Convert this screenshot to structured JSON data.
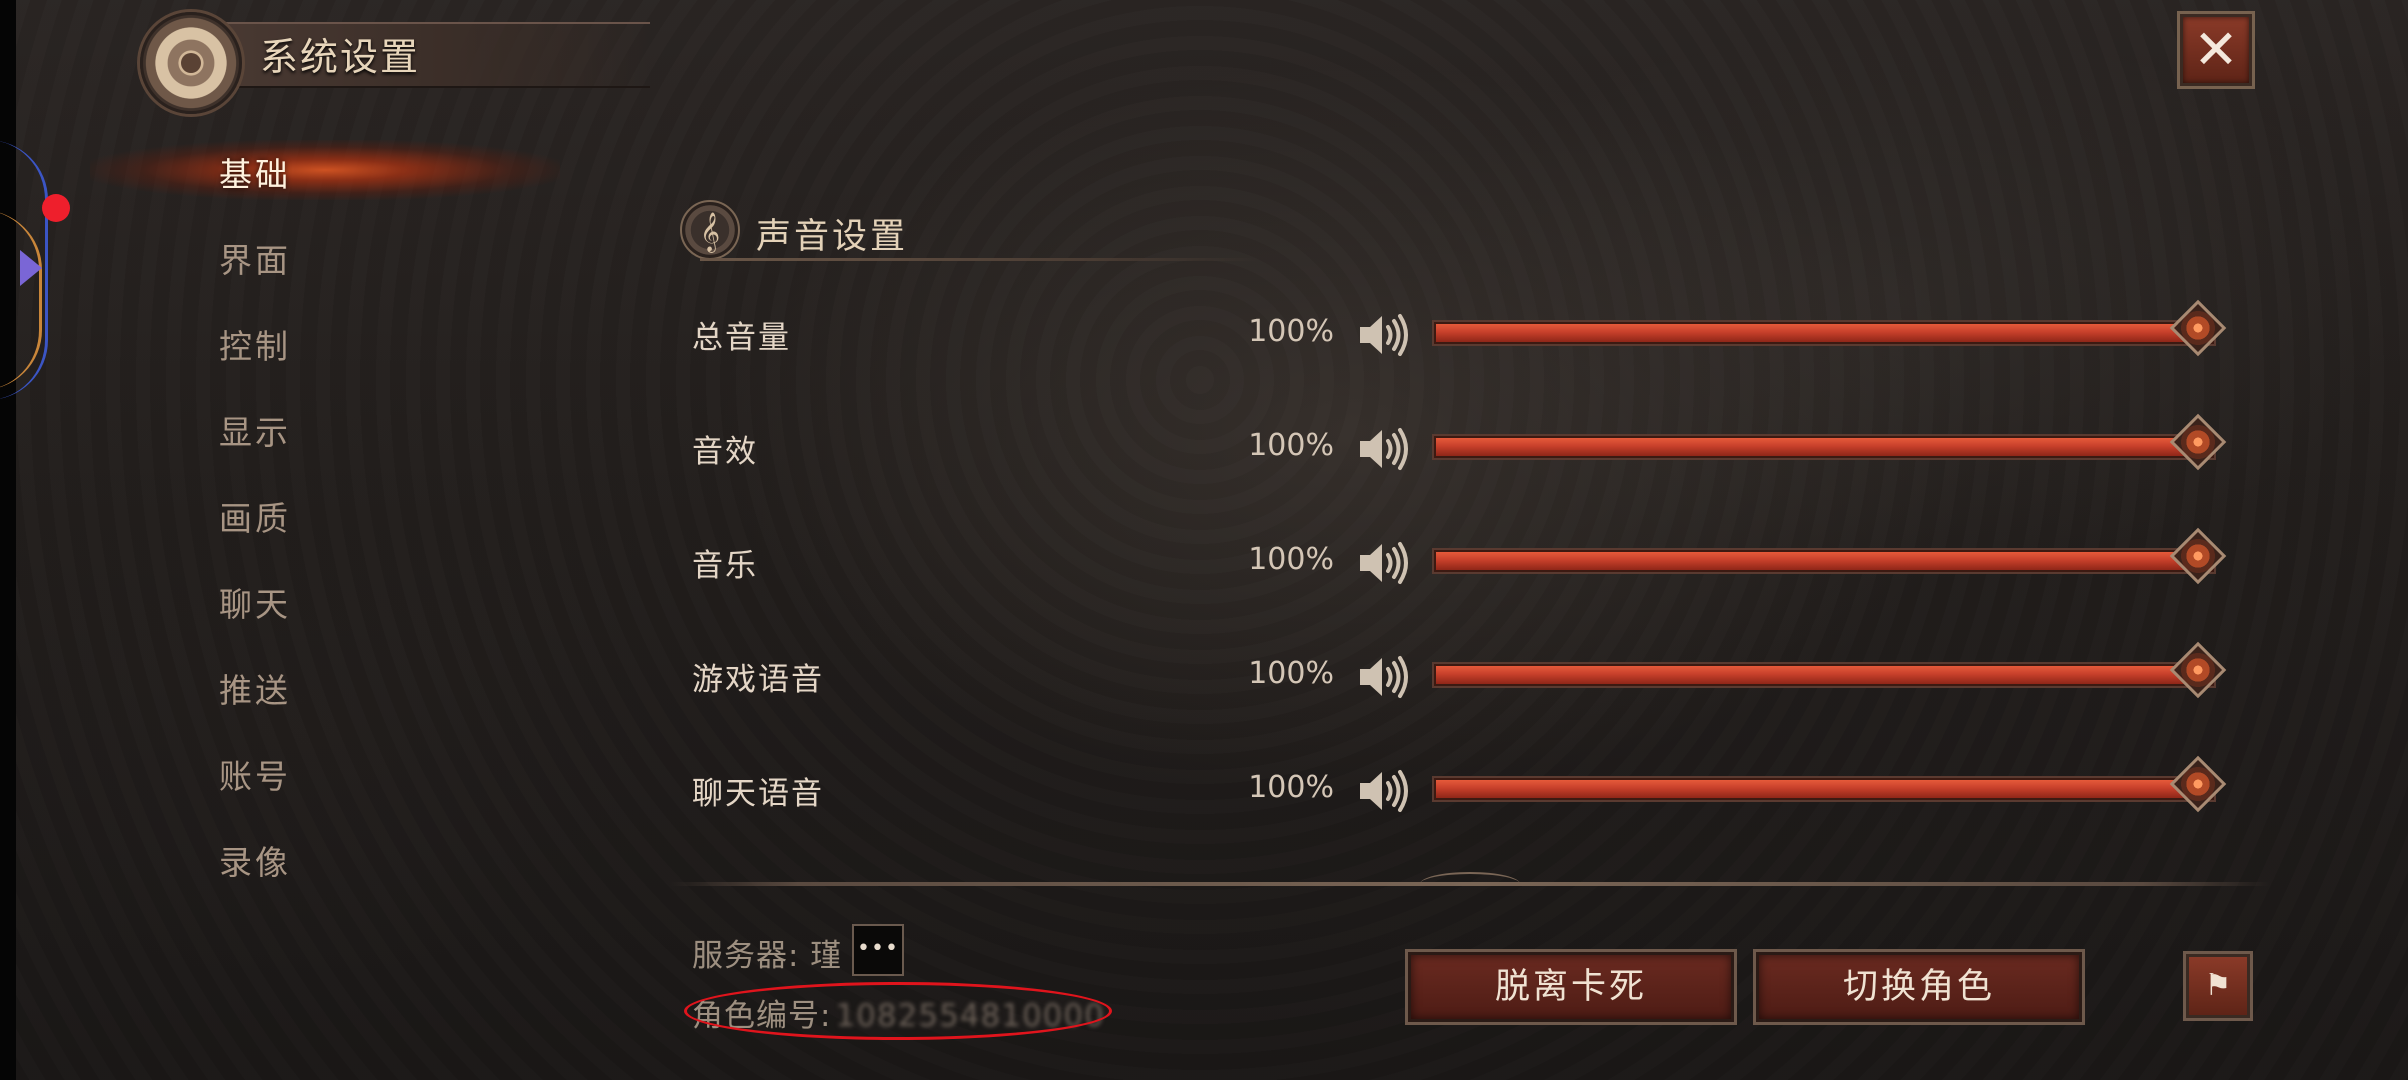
{
  "header": {
    "title": "系统设置",
    "icon": "gear-icon",
    "close_label": "✕"
  },
  "nav": {
    "items": [
      {
        "label": "基础",
        "active": true
      },
      {
        "label": "界面",
        "active": false
      },
      {
        "label": "控制",
        "active": false
      },
      {
        "label": "显示",
        "active": false
      },
      {
        "label": "画质",
        "active": false
      },
      {
        "label": "聊天",
        "active": false
      },
      {
        "label": "推送",
        "active": false
      },
      {
        "label": "账号",
        "active": false
      },
      {
        "label": "录像",
        "active": false
      }
    ]
  },
  "sound": {
    "section_title": "声音设置",
    "section_icon": "treble-clef-icon",
    "rows": [
      {
        "label": "总音量",
        "value_text": "100%",
        "level": 1.0
      },
      {
        "label": "音效",
        "value_text": "100%",
        "level": 1.0
      },
      {
        "label": "音乐",
        "value_text": "100%",
        "level": 1.0
      },
      {
        "label": "游戏语音",
        "value_text": "100%",
        "level": 1.0
      },
      {
        "label": "聊天语音",
        "value_text": "100%",
        "level": 1.0
      }
    ]
  },
  "footer": {
    "server_label": "服务器: 瑾",
    "server_more_label": "•••",
    "role_id_label": "角色编号:",
    "role_id_value": "1082554810000",
    "unstuck_button": "脱离卡死",
    "switch_role_button": "切换角色",
    "flag_icon": "flag-icon"
  },
  "colors": {
    "accent_slider": "#c7402b",
    "active_glow": "#d65422",
    "annotation_ring": "#e0141c"
  }
}
